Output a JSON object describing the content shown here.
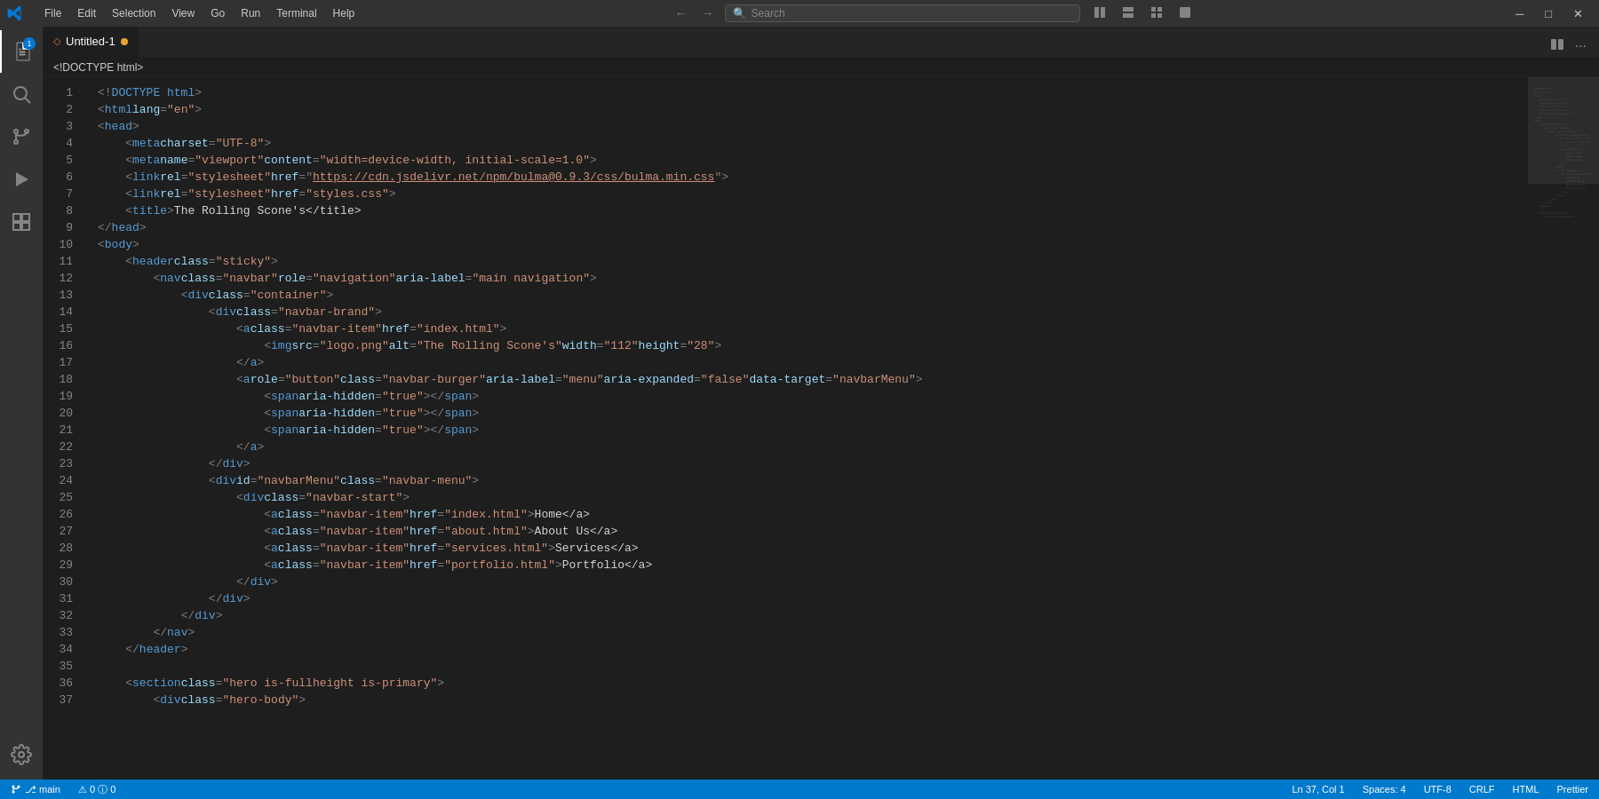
{
  "titlebar": {
    "menu_items": [
      "File",
      "Edit",
      "Selection",
      "View",
      "Go",
      "Run",
      "Terminal",
      "Help"
    ],
    "search_placeholder": "Search",
    "nav_back": "←",
    "nav_forward": "→",
    "win_minimize": "─",
    "win_maximize": "□",
    "win_close": "✕"
  },
  "tabs": [
    {
      "label": "<!DOCTYPE html>",
      "filename": "Untitled-1",
      "active": true,
      "modified": true,
      "icon": "◇"
    }
  ],
  "breadcrumb": {
    "parts": [
      "<!DOCTYPE html>"
    ]
  },
  "editor": {
    "lines": [
      {
        "num": 1,
        "content": "<!DOCTYPE html>"
      },
      {
        "num": 2,
        "content": "<html lang=\"en\">"
      },
      {
        "num": 3,
        "content": "<head>"
      },
      {
        "num": 4,
        "content": "    <meta charset=\"UTF-8\">"
      },
      {
        "num": 5,
        "content": "    <meta name=\"viewport\" content=\"width=device-width, initial-scale=1.0\">"
      },
      {
        "num": 6,
        "content": "    <link rel=\"stylesheet\" href=\"https://cdn.jsdelivr.net/npm/bulma@0.9.3/css/bulma.min.css\">"
      },
      {
        "num": 7,
        "content": "    <link rel=\"stylesheet\" href=\"styles.css\">"
      },
      {
        "num": 8,
        "content": "    <title>The Rolling Scone's</title>"
      },
      {
        "num": 9,
        "content": "</head>"
      },
      {
        "num": 10,
        "content": "<body>"
      },
      {
        "num": 11,
        "content": "    <header class=\"sticky\">"
      },
      {
        "num": 12,
        "content": "        <nav class=\"navbar\" role=\"navigation\" aria-label=\"main navigation\">"
      },
      {
        "num": 13,
        "content": "            <div class=\"container\">"
      },
      {
        "num": 14,
        "content": "                <div class=\"navbar-brand\">"
      },
      {
        "num": 15,
        "content": "                    <a class=\"navbar-item\" href=\"index.html\">"
      },
      {
        "num": 16,
        "content": "                        <img src=\"logo.png\" alt=\"The Rolling Scone's\" width=\"112\" height=\"28\">"
      },
      {
        "num": 17,
        "content": "                    </a>"
      },
      {
        "num": 18,
        "content": "                    <a role=\"button\" class=\"navbar-burger\" aria-label=\"menu\" aria-expanded=\"false\" data-target=\"navbarMenu\">"
      },
      {
        "num": 19,
        "content": "                        <span aria-hidden=\"true\"></span>"
      },
      {
        "num": 20,
        "content": "                        <span aria-hidden=\"true\"></span>"
      },
      {
        "num": 21,
        "content": "                        <span aria-hidden=\"true\"></span>"
      },
      {
        "num": 22,
        "content": "                    </a>"
      },
      {
        "num": 23,
        "content": "                </div>"
      },
      {
        "num": 24,
        "content": "                <div id=\"navbarMenu\" class=\"navbar-menu\">"
      },
      {
        "num": 25,
        "content": "                    <div class=\"navbar-start\">"
      },
      {
        "num": 26,
        "content": "                        <a class=\"navbar-item\" href=\"index.html\">Home</a>"
      },
      {
        "num": 27,
        "content": "                        <a class=\"navbar-item\" href=\"about.html\">About Us</a>"
      },
      {
        "num": 28,
        "content": "                        <a class=\"navbar-item\" href=\"services.html\">Services</a>"
      },
      {
        "num": 29,
        "content": "                        <a class=\"navbar-item\" href=\"portfolio.html\">Portfolio</a>"
      },
      {
        "num": 30,
        "content": "                    </div>"
      },
      {
        "num": 31,
        "content": "                </div>"
      },
      {
        "num": 32,
        "content": "            </div>"
      },
      {
        "num": 33,
        "content": "        </nav>"
      },
      {
        "num": 34,
        "content": "    </header>"
      },
      {
        "num": 35,
        "content": ""
      },
      {
        "num": 36,
        "content": "    <section class=\"hero is-fullheight is-primary\">"
      },
      {
        "num": 37,
        "content": "        <div class=\"hero-body\">"
      }
    ]
  },
  "activity_bar": {
    "items": [
      {
        "icon": "⎘",
        "name": "explorer",
        "active": true,
        "badge": "1"
      },
      {
        "icon": "🔍",
        "name": "search",
        "active": false
      },
      {
        "icon": "⑂",
        "name": "source-control",
        "active": false
      },
      {
        "icon": "▷",
        "name": "run-debug",
        "active": false
      },
      {
        "icon": "⧉",
        "name": "extensions",
        "active": false
      }
    ],
    "bottom": [
      {
        "icon": "⚙",
        "name": "settings"
      }
    ]
  },
  "status_bar": {
    "left": [
      {
        "label": "⎇ main",
        "name": "git-branch"
      },
      {
        "label": "⚠ 0   ⓘ 0",
        "name": "problems"
      }
    ],
    "right": [
      {
        "label": "Ln 37, Col 1",
        "name": "cursor-position"
      },
      {
        "label": "Spaces: 4",
        "name": "indentation"
      },
      {
        "label": "UTF-8",
        "name": "encoding"
      },
      {
        "label": "CRLF",
        "name": "eol"
      },
      {
        "label": "HTML",
        "name": "language-mode"
      },
      {
        "label": "Prettier",
        "name": "formatter"
      }
    ]
  }
}
